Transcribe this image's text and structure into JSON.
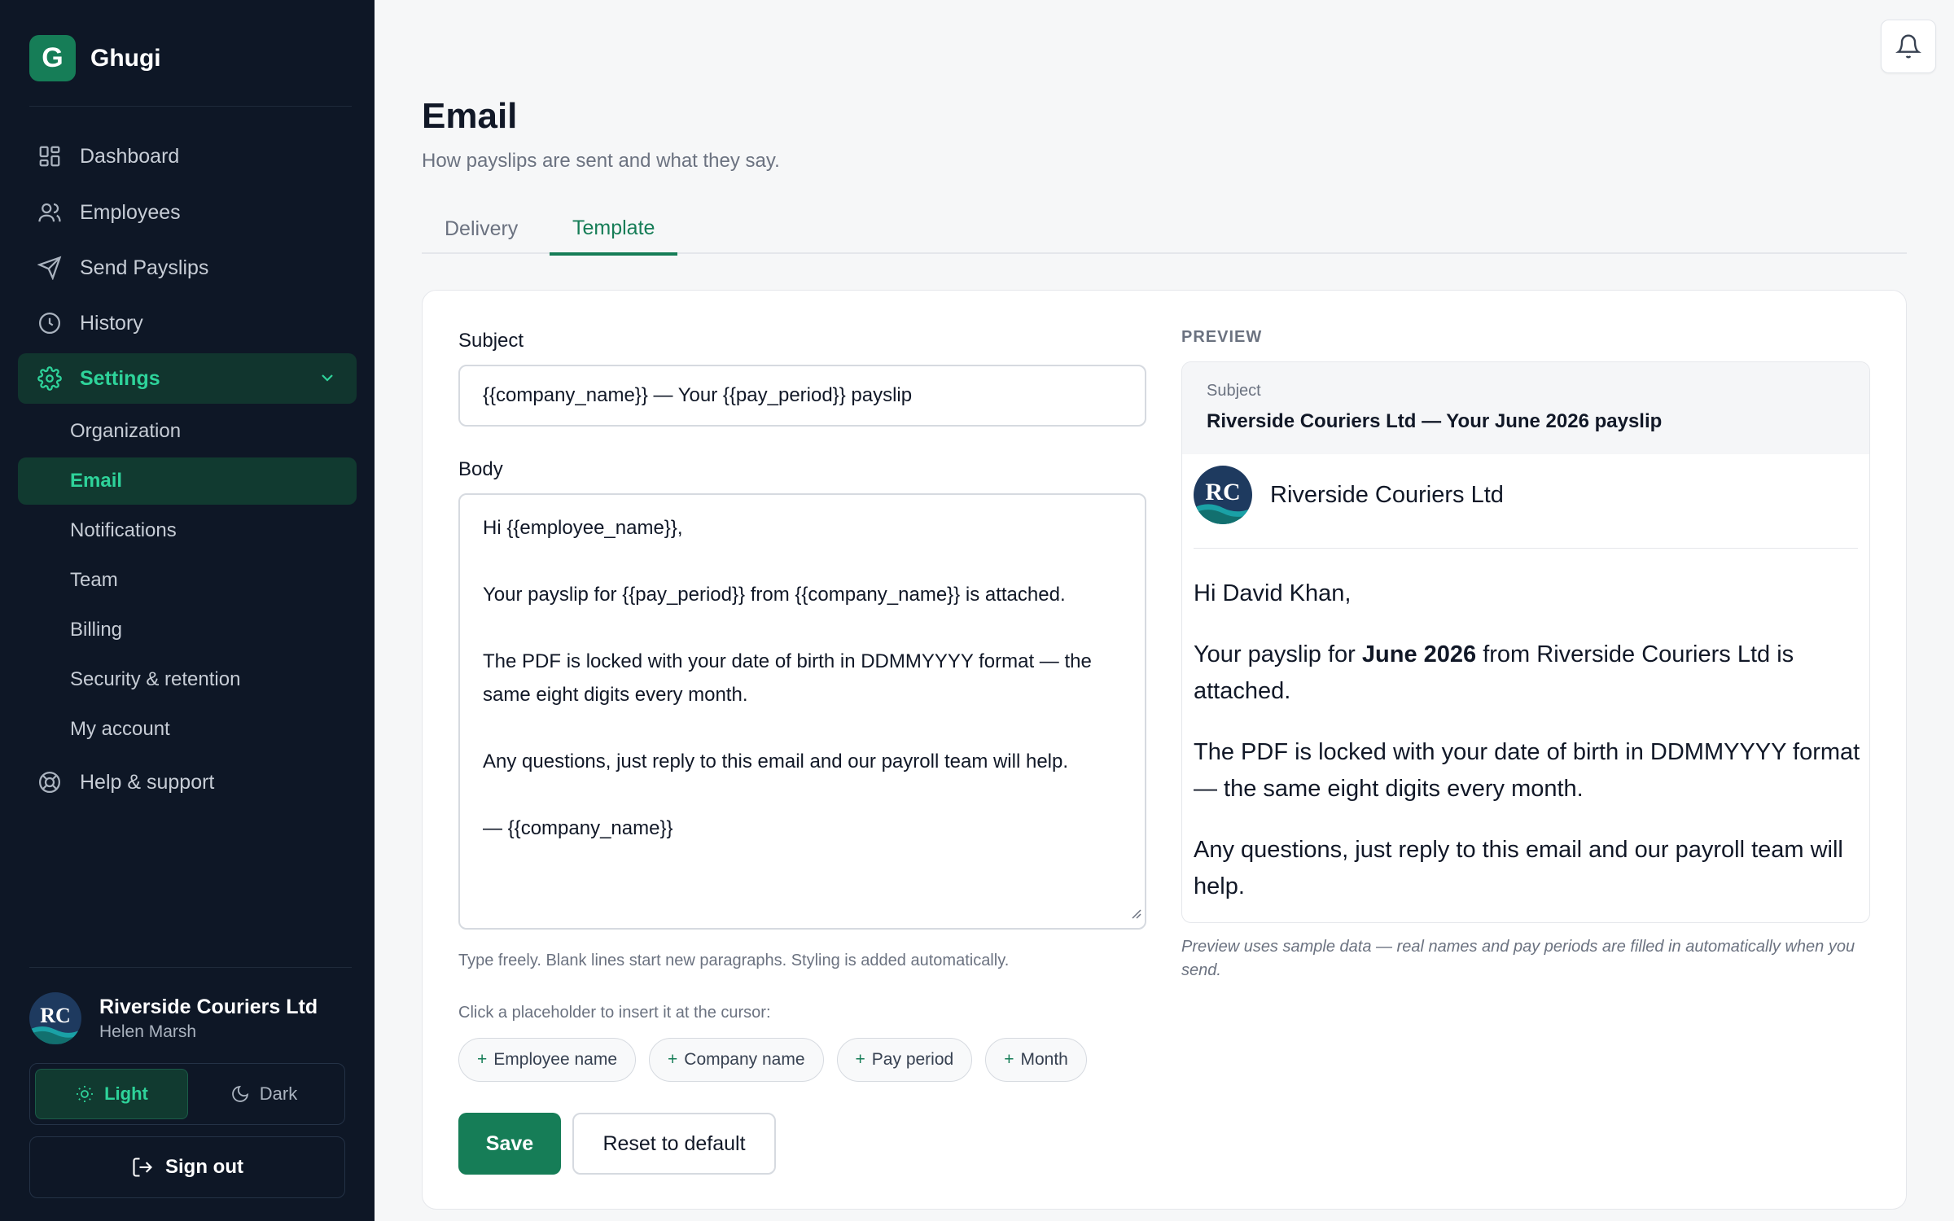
{
  "brand": {
    "logo_letter": "G",
    "name": "Ghugi",
    "accent": "#167d57"
  },
  "sidebar": {
    "items": [
      {
        "label": "Dashboard",
        "icon": "dashboard-icon"
      },
      {
        "label": "Employees",
        "icon": "users-icon"
      },
      {
        "label": "Send Payslips",
        "icon": "send-icon"
      },
      {
        "label": "History",
        "icon": "clock-icon"
      },
      {
        "label": "Settings",
        "icon": "gear-icon",
        "expanded": true
      },
      {
        "label": "Help & support",
        "icon": "lifebuoy-icon"
      }
    ],
    "settings_sub": [
      "Organization",
      "Email",
      "Notifications",
      "Team",
      "Billing",
      "Security & retention",
      "My account"
    ],
    "active_sub": "Email"
  },
  "account": {
    "org_name": "Riverside Couriers Ltd",
    "user_name": "Helen Marsh",
    "monogram": "RC"
  },
  "theme": {
    "light_label": "Light",
    "dark_label": "Dark",
    "selected": "Light"
  },
  "signout_label": "Sign out",
  "page": {
    "title": "Email",
    "subtitle": "How payslips are sent and what they say.",
    "tabs": [
      "Delivery",
      "Template"
    ],
    "active_tab": "Template"
  },
  "editor": {
    "subject_label": "Subject",
    "subject_value": "{{company_name}} — Your {{pay_period}} payslip",
    "body_label": "Body",
    "body_lines": [
      "Hi {{employee_name}},",
      "",
      "Your payslip for {{pay_period}} from {{company_name}} is attached.",
      "",
      "The PDF is locked with your date of birth in DDMMYYYY format — the",
      "same eight digits every month.",
      "",
      "Any questions, just reply to this email and our payroll team will help.",
      "",
      "— {{company_name}}"
    ],
    "body_hint": "Type freely. Blank lines start new paragraphs. Styling is added automatically.",
    "placeholder_hint": "Click a placeholder to insert it at the cursor:",
    "placeholders": [
      "Employee name",
      "Company name",
      "Pay period",
      "Month"
    ],
    "save_label": "Save",
    "reset_label": "Reset to default"
  },
  "preview": {
    "label": "PREVIEW",
    "subject_label": "Subject",
    "subject": "Riverside Couriers Ltd — Your June 2026 payslip",
    "company_monogram": "RC",
    "company_name": "Riverside Couriers Ltd",
    "greeting": "Hi David Khan,",
    "p1_before": "Your payslip for ",
    "p1_bold": "June 2026",
    "p1_after": " from Riverside Couriers Ltd is attached.",
    "p2": "The PDF is locked with your date of birth in DDMMYYYY format — the same eight digits every month.",
    "p3": "Any questions, just reply to this email and our payroll team will help.",
    "note": "Preview uses sample data — real names and pay periods are filled in automatically when you send."
  }
}
